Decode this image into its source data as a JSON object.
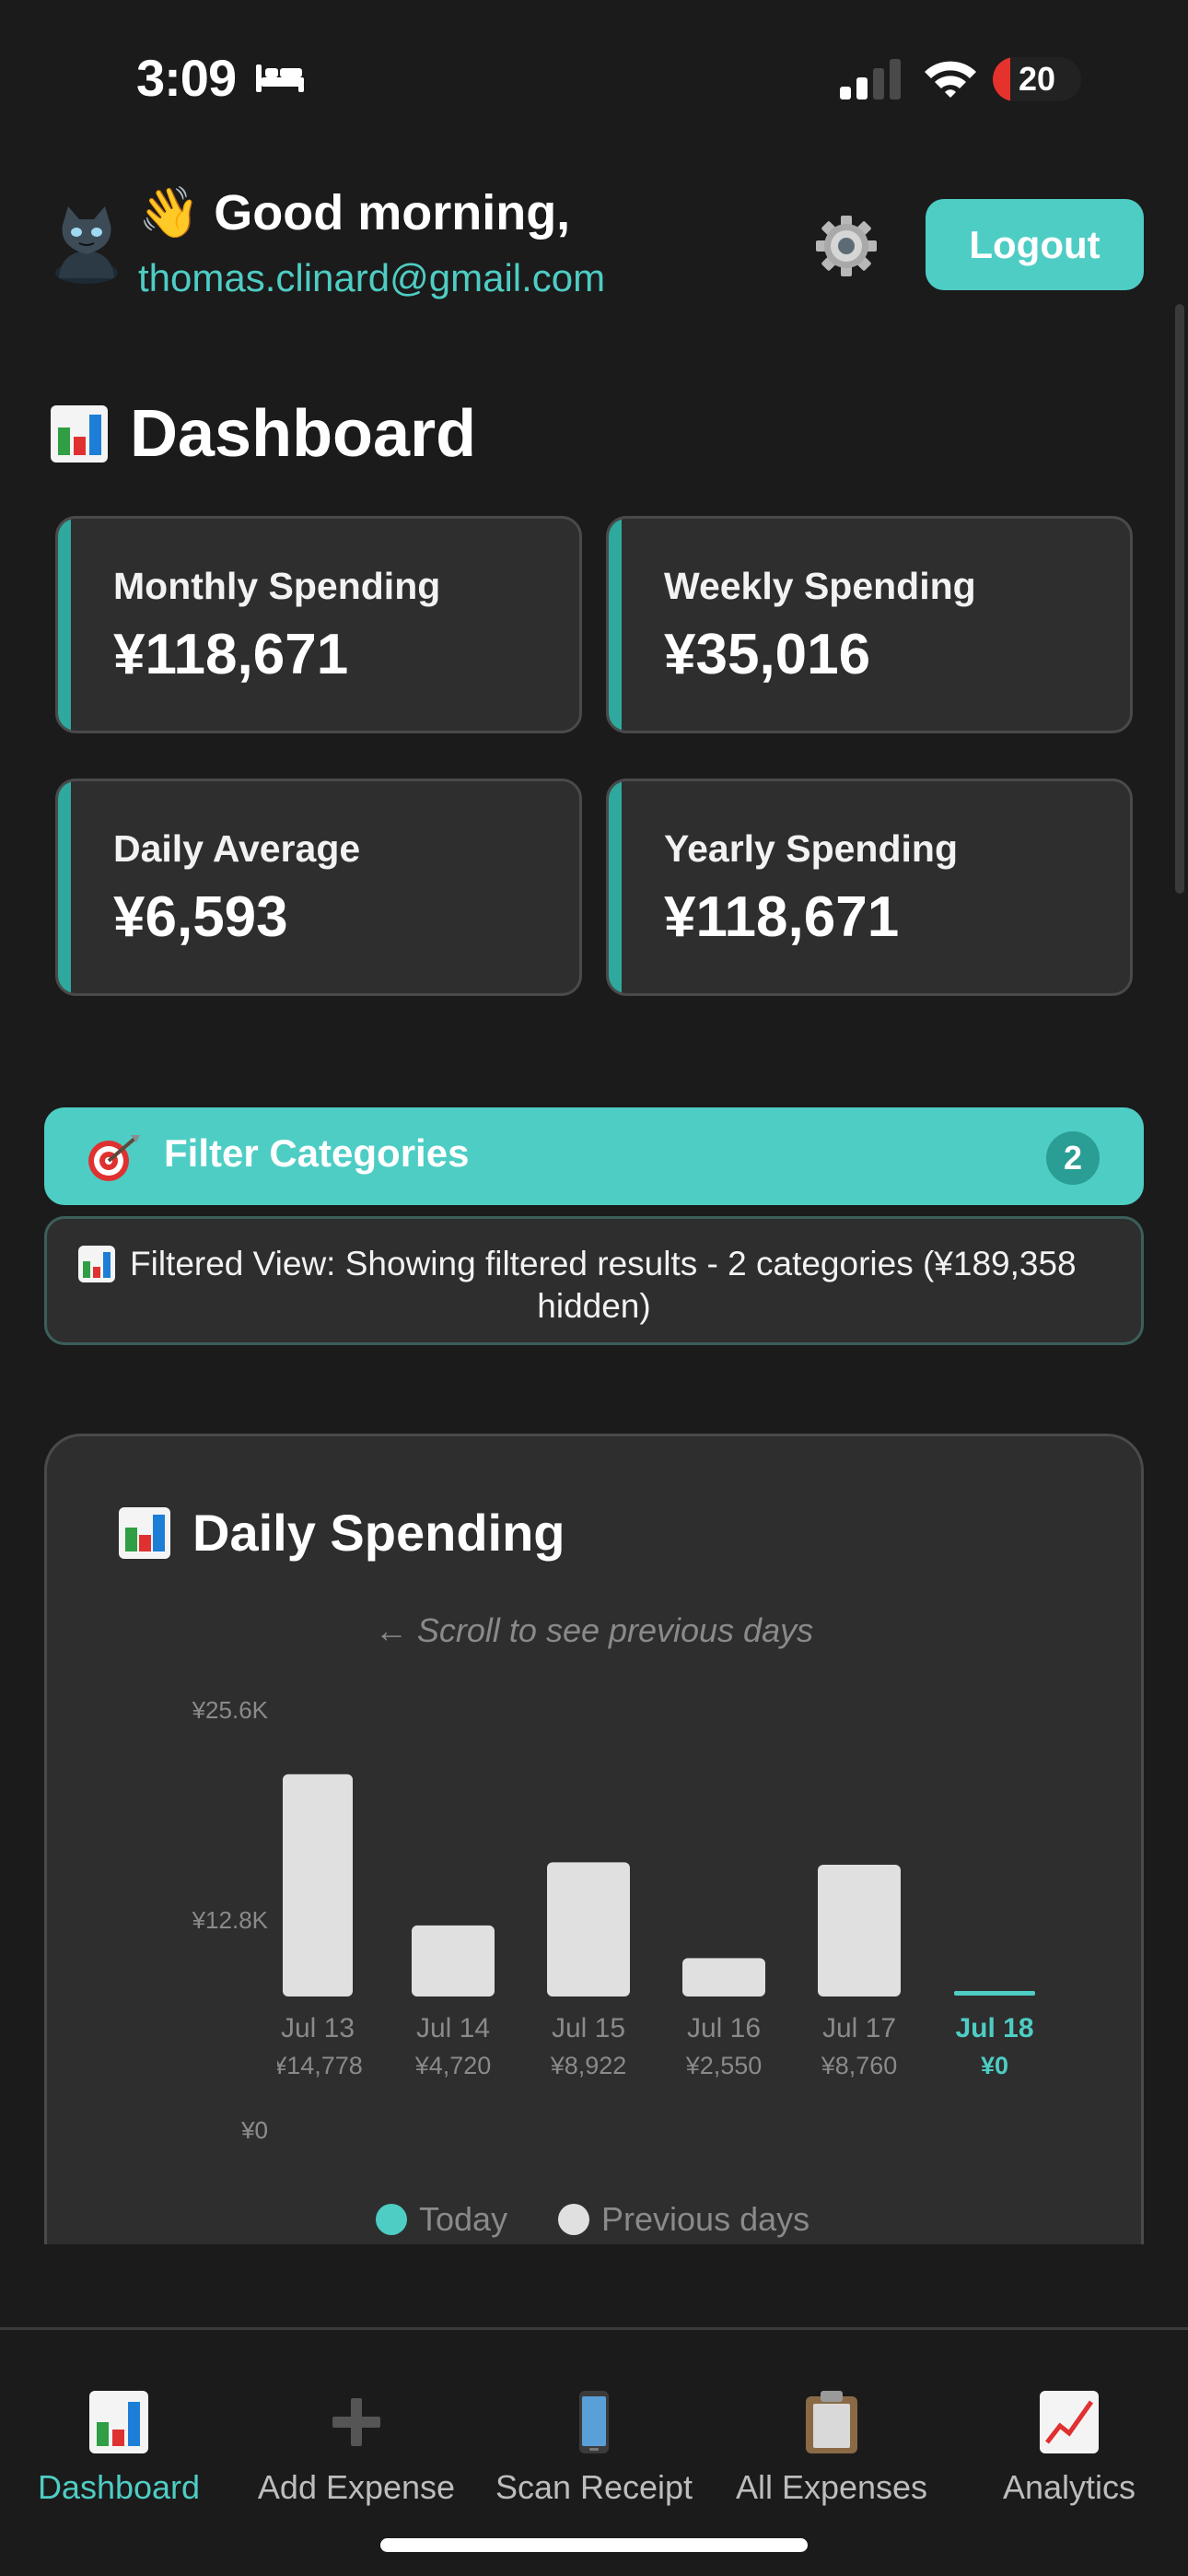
{
  "status_bar": {
    "time": "3:09",
    "battery": "20",
    "battery_level": 0.2
  },
  "header": {
    "greeting": "👋 Good morning,",
    "email": "thomas.clinard@gmail.com",
    "logout_label": "Logout"
  },
  "dashboard": {
    "title": "Dashboard"
  },
  "stats": [
    {
      "label": "Monthly Spending",
      "value": "¥118,671"
    },
    {
      "label": "Weekly Spending",
      "value": "¥35,016"
    },
    {
      "label": "Daily Average",
      "value": "¥6,593"
    },
    {
      "label": "Yearly Spending",
      "value": "¥118,671"
    }
  ],
  "filter": {
    "label": "Filter Categories",
    "count": "2",
    "notice_line1": "Filtered View: Showing filtered results - 2 categories (¥189,358",
    "notice_line2": "hidden)"
  },
  "daily": {
    "title": "Daily Spending",
    "scroll_hint": "← Scroll to see previous days"
  },
  "chart_data": {
    "type": "bar",
    "categories": [
      "Jul 13",
      "Jul 14",
      "Jul 15",
      "Jul 16",
      "Jul 17",
      "Jul 18"
    ],
    "values": [
      14778,
      4720,
      8922,
      2550,
      8760,
      0
    ],
    "value_labels": [
      "¥14,778",
      "¥4,720",
      "¥8,922",
      "¥2,550",
      "¥8,760",
      "¥0"
    ],
    "y_ticks": [
      "¥25.6K",
      "¥12.8K",
      "¥0"
    ],
    "ylim": [
      0,
      25600
    ],
    "highlight_index": 5,
    "legend": [
      "Today",
      "Previous days"
    ],
    "colors": {
      "bar": "#e0e0e0",
      "today": "#4ecdc4",
      "axis_text": "#8a8a8a"
    }
  },
  "nav": {
    "items": [
      {
        "label": "Dashboard",
        "icon": "bar-chart-icon",
        "active": true
      },
      {
        "label": "Add Expense",
        "icon": "plus-icon",
        "active": false
      },
      {
        "label": "Scan Receipt",
        "icon": "phone-icon",
        "active": false
      },
      {
        "label": "All Expenses",
        "icon": "clipboard-icon",
        "active": false
      },
      {
        "label": "Analytics",
        "icon": "trend-chart-icon",
        "active": false
      }
    ]
  }
}
